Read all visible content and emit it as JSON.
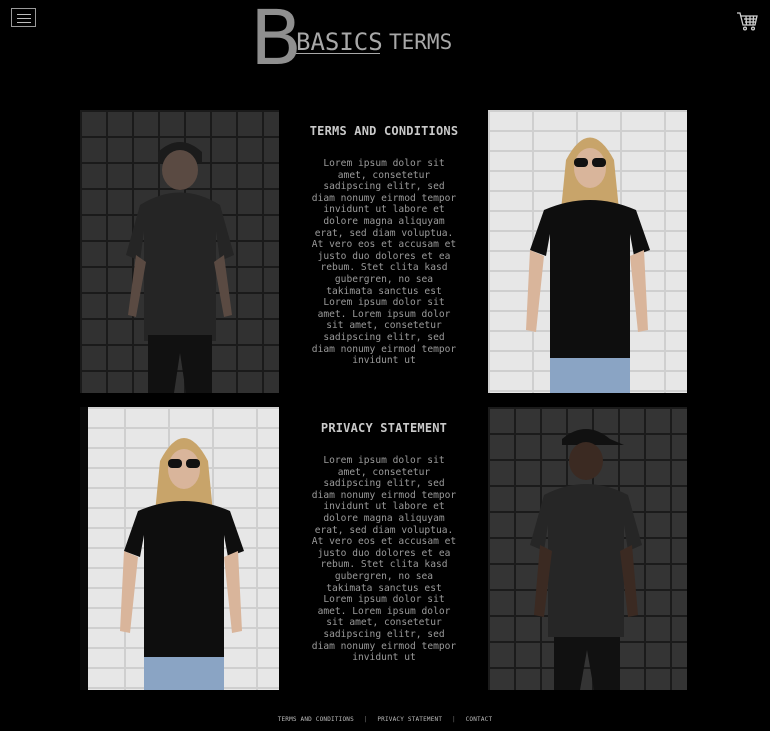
{
  "header": {
    "menu_icon": "hamburger-menu-icon",
    "logo": {
      "letter": "B",
      "brand": "BASICS",
      "page": "TERMS"
    },
    "cart_icon": "shopping-cart-icon"
  },
  "sections": [
    {
      "title": "TERMS AND CONDITIONS",
      "body": "Lorem ipsum dolor sit amet, consetetur sadipscing elitr, sed diam nonumy eirmod tempor invidunt ut labore et dolore magna aliquyam erat, sed diam voluptua. At vero eos et accusam et justo duo dolores et ea rebum. Stet clita kasd gubergren, no sea takimata sanctus est Lorem ipsum dolor sit amet. Lorem ipsum dolor sit amet, consetetur sadipscing elitr, sed diam nonumy eirmod tempor invidunt ut"
    },
    {
      "title": "PRIVACY STATEMENT",
      "body": "Lorem ipsum dolor sit amet, consetetur sadipscing elitr, sed diam nonumy eirmod tempor invidunt ut labore et dolore magna aliquyam erat, sed diam voluptua. At vero eos et accusam et justo duo dolores et ea rebum. Stet clita kasd gubergren, no sea takimata sanctus est Lorem ipsum dolor sit amet. Lorem ipsum dolor sit amet, consetetur sadipscing elitr, sed diam nonumy eirmod tempor invidunt ut"
    }
  ],
  "photos": [
    {
      "subject": "man in black cap and black t-shirt against dark brick wall"
    },
    {
      "subject": "blonde woman in sunglasses and black t-shirt against white brick wall"
    },
    {
      "subject": "blonde woman in sunglasses and black t-shirt against white brick wall"
    },
    {
      "subject": "man in black cap and black t-shirt against dark brick wall"
    }
  ],
  "footer": {
    "links": [
      "TERMS AND CONDITIONS",
      "PRIVACY STATEMENT",
      "CONTACT"
    ],
    "separator": "|"
  },
  "colors": {
    "background": "#000000",
    "text": "#9a9a9a",
    "logo": "#8f8f8f"
  }
}
